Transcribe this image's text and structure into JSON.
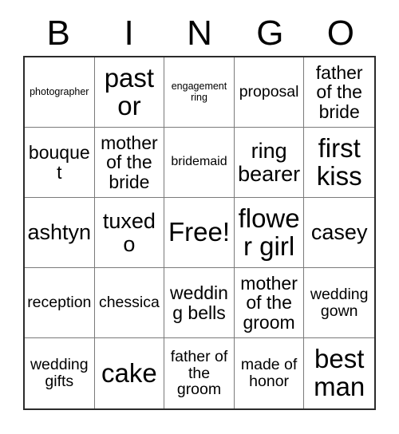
{
  "card": {
    "header_letters": [
      "B",
      "I",
      "N",
      "G",
      "O"
    ],
    "rows": [
      [
        {
          "label": "photographer",
          "size": "fs-xs"
        },
        {
          "label": "pastor",
          "size": "fs-xxl"
        },
        {
          "label": "engagement ring",
          "size": "fs-xs"
        },
        {
          "label": "proposal",
          "size": "fs-md"
        },
        {
          "label": "father of the bride",
          "size": "fs-lg"
        }
      ],
      [
        {
          "label": "bouquet",
          "size": "fs-lg"
        },
        {
          "label": "mother of the bride",
          "size": "fs-lg"
        },
        {
          "label": "bridemaid",
          "size": "fs-sm"
        },
        {
          "label": "ring bearer",
          "size": "fs-xl"
        },
        {
          "label": "first kiss",
          "size": "fs-xxl"
        }
      ],
      [
        {
          "label": "ashtyn",
          "size": "fs-xl"
        },
        {
          "label": "tuxedo",
          "size": "fs-xl"
        },
        {
          "label": "Free!",
          "size": "fs-xxl"
        },
        {
          "label": "flower girl",
          "size": "fs-xxl"
        },
        {
          "label": "casey",
          "size": "fs-xl"
        }
      ],
      [
        {
          "label": "reception",
          "size": "fs-md"
        },
        {
          "label": "chessica",
          "size": "fs-md"
        },
        {
          "label": "wedding bells",
          "size": "fs-lg"
        },
        {
          "label": "mother of the groom",
          "size": "fs-lg"
        },
        {
          "label": "wedding gown",
          "size": "fs-md"
        }
      ],
      [
        {
          "label": "wedding gifts",
          "size": "fs-md"
        },
        {
          "label": "cake",
          "size": "fs-xxl"
        },
        {
          "label": "father of the groom",
          "size": "fs-md"
        },
        {
          "label": "made of honor",
          "size": "fs-md"
        },
        {
          "label": "best man",
          "size": "fs-xxl"
        }
      ]
    ]
  },
  "colors": {
    "background": "#ffffff",
    "text": "#000000",
    "outer_border": "#2b2b2b",
    "inner_border": "#7a7a7a"
  }
}
